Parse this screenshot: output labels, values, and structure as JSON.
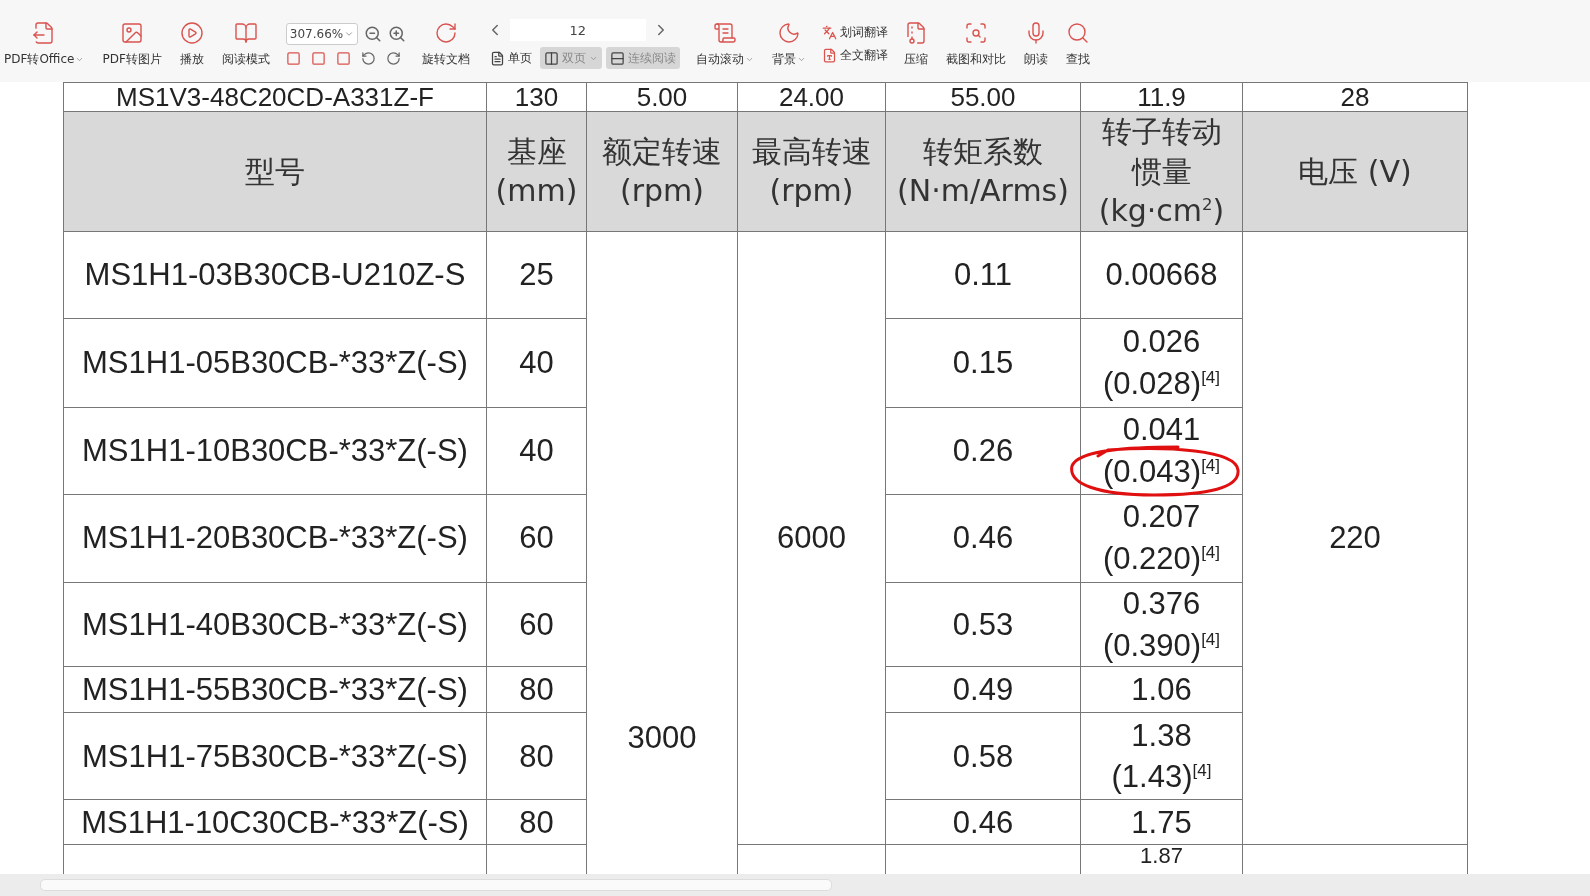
{
  "toolbar": {
    "items": [
      {
        "kind": "big",
        "label": "PDF转Office",
        "dropdown": true
      },
      {
        "kind": "big",
        "label": "PDF转图片",
        "dropdown": false
      },
      {
        "kind": "big",
        "label": "播放",
        "dropdown": false
      },
      {
        "kind": "big",
        "label": "阅读模式",
        "dropdown": false
      },
      {
        "kind": "zoom",
        "value": "307.66%"
      },
      {
        "kind": "big",
        "label": "旋转文档",
        "dropdown": false
      },
      {
        "kind": "pages",
        "page": "12",
        "views": [
          {
            "label": "单页",
            "selected": false,
            "dropdown": false
          },
          {
            "label": "双页",
            "selected": true,
            "dropdown": true
          },
          {
            "label": "连续阅读",
            "selected": true,
            "dropdown": false
          }
        ]
      },
      {
        "kind": "big",
        "label": "自动滚动",
        "dropdown": true
      },
      {
        "kind": "big",
        "label": "背景",
        "dropdown": true
      },
      {
        "kind": "stack",
        "entries": [
          {
            "label": "划词翻译"
          },
          {
            "label": "全文翻译"
          }
        ]
      },
      {
        "kind": "big",
        "label": "压缩",
        "dropdown": false
      },
      {
        "kind": "big",
        "label": "截图和对比",
        "dropdown": false
      },
      {
        "kind": "big",
        "label": "朗读",
        "dropdown": false
      },
      {
        "kind": "big",
        "label": "查找",
        "dropdown": false
      }
    ]
  },
  "table": {
    "top_row": [
      "MS1V3-48C20CD-A331Z-F",
      "130",
      "5.00",
      "24.00",
      "55.00",
      "11.9",
      "28"
    ],
    "columns": [
      [
        "型号"
      ],
      [
        "基座",
        "(mm)"
      ],
      [
        "额定转速",
        "(rpm)"
      ],
      [
        "最高转速",
        "(rpm)"
      ],
      [
        "转矩系数",
        "(N·m/Arms)"
      ],
      [
        "转子转动",
        "惯量",
        "(kg·cm$^{2}$)"
      ],
      [
        "电压 (V)"
      ]
    ],
    "rated_speed": "3000",
    "max_speed": "6000",
    "voltage": "220",
    "rows": [
      {
        "model": "MS1H1-03B30CB-U210Z-S",
        "frame": "25",
        "torque": "0.11",
        "inertia": [
          "0.00668"
        ]
      },
      {
        "model": "MS1H1-05B30CB-*33*Z(-S)",
        "frame": "40",
        "torque": "0.15",
        "inertia": [
          "0.026",
          "(0.028)$^{[4]}$"
        ]
      },
      {
        "model": "MS1H1-10B30CB-*33*Z(-S)",
        "frame": "40",
        "torque": "0.26",
        "inertia": [
          "0.041",
          "(0.043)$^{[4]}$"
        ]
      },
      {
        "model": "MS1H1-20B30CB-*33*Z(-S)",
        "frame": "60",
        "torque": "0.46",
        "inertia": [
          "0.207",
          "(0.220)$^{[4]}$"
        ]
      },
      {
        "model": "MS1H1-40B30CB-*33*Z(-S)",
        "frame": "60",
        "torque": "0.53",
        "inertia": [
          "0.376",
          "(0.390)$^{[4]}$"
        ]
      },
      {
        "model": "MS1H1-55B30CB-*33*Z(-S)",
        "frame": "80",
        "torque": "0.49",
        "inertia": [
          "1.06"
        ]
      },
      {
        "model": "MS1H1-75B30CB-*33*Z(-S)",
        "frame": "80",
        "torque": "0.58",
        "inertia": [
          "1.38",
          "(1.43)$^{[4]}$"
        ]
      },
      {
        "model": "MS1H1-10C30CB-*33*Z(-S)",
        "frame": "80",
        "torque": "0.46",
        "inertia": [
          "1.75"
        ]
      }
    ],
    "bottom_row": {
      "inertia": "1.87"
    }
  }
}
